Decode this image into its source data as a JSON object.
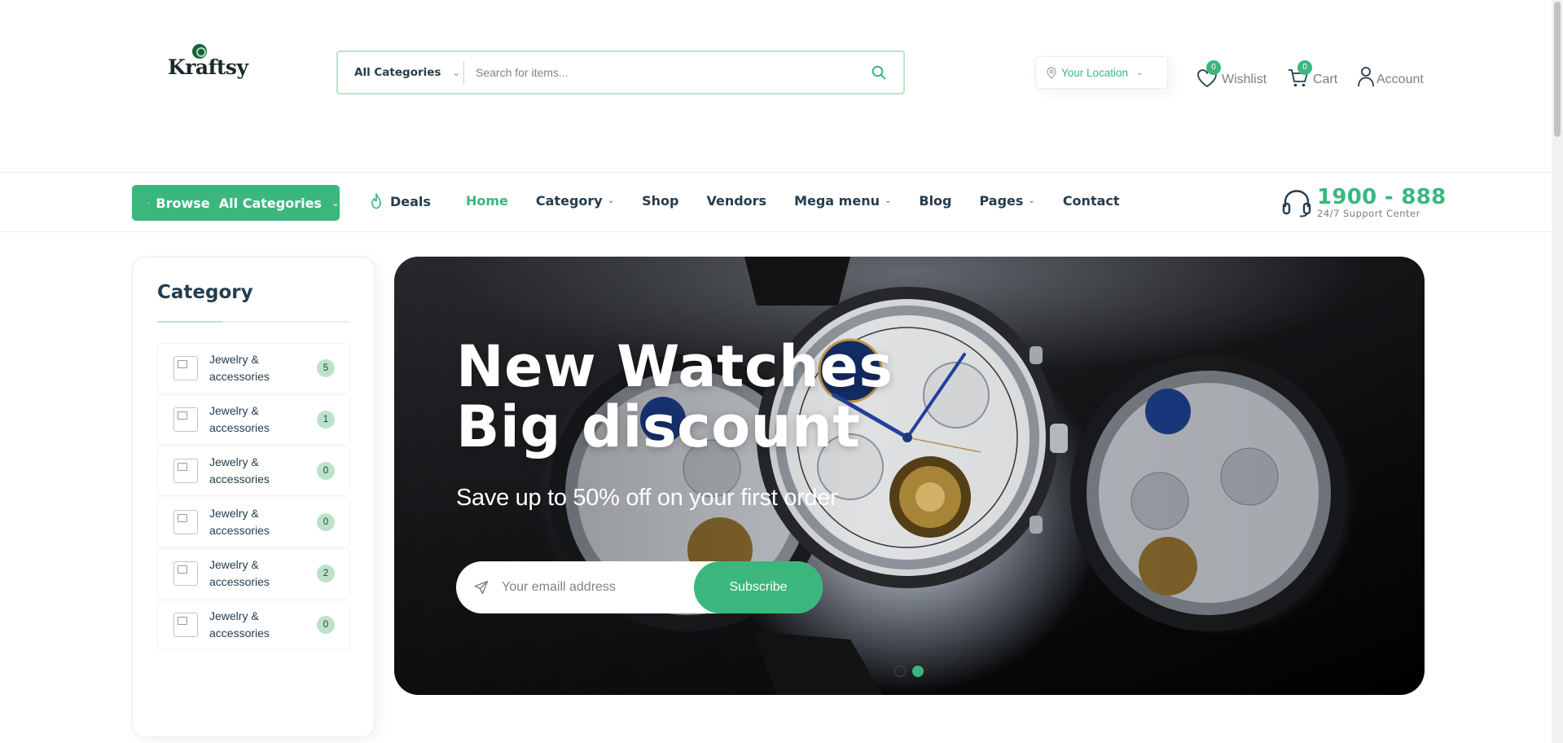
{
  "header": {
    "logo_text": "Kraftsy",
    "search": {
      "category_label": "All Categories",
      "placeholder": "Search for items..."
    },
    "location_label": "Your Location",
    "wishlist": {
      "label": "Wishlist",
      "count": "0"
    },
    "cart": {
      "label": "Cart",
      "count": "0"
    },
    "account_label": "Account"
  },
  "nav": {
    "browse_label": "Browse  All Categories",
    "deals_label": "Deals",
    "links": [
      {
        "label": "Home",
        "active": true,
        "dropdown": false
      },
      {
        "label": "Category",
        "active": false,
        "dropdown": true
      },
      {
        "label": "Shop",
        "active": false,
        "dropdown": false
      },
      {
        "label": "Vendors",
        "active": false,
        "dropdown": false
      },
      {
        "label": "Mega menu",
        "active": false,
        "dropdown": true
      },
      {
        "label": "Blog",
        "active": false,
        "dropdown": false
      },
      {
        "label": "Pages",
        "active": false,
        "dropdown": true
      },
      {
        "label": "Contact",
        "active": false,
        "dropdown": false
      }
    ],
    "support_number": "1900 - 888",
    "support_label": "24/7 Support Center"
  },
  "sidebar": {
    "title": "Category",
    "items": [
      {
        "name": "Jewelry & accessories",
        "count": "5"
      },
      {
        "name": "Jewelry & accessories",
        "count": "1"
      },
      {
        "name": "Jewelry & accessories",
        "count": "0"
      },
      {
        "name": "Jewelry & accessories",
        "count": "0"
      },
      {
        "name": "Jewelry & accessories",
        "count": "2"
      },
      {
        "name": "Jewelry & accessories",
        "count": "0"
      }
    ]
  },
  "hero": {
    "title_line1": "New Watches",
    "title_line2": "Big discount",
    "subtitle": "Save up to 50% off on your first order",
    "email_placeholder": "Your emaill address",
    "subscribe_label": "Subscribe",
    "slides_total": 2,
    "active_slide": 2
  },
  "colors": {
    "brand_green": "#3BB77E",
    "light_green": "#BCE3C9",
    "heading": "#253D4E",
    "muted": "#7E7E7E"
  },
  "icons": {
    "search": "search-icon",
    "location": "location-pin-icon",
    "wishlist": "heart-icon",
    "cart": "cart-icon",
    "account": "user-icon",
    "browse": "grid-icon",
    "deals": "flame-icon",
    "support": "headset-icon",
    "send": "paper-plane-icon"
  }
}
